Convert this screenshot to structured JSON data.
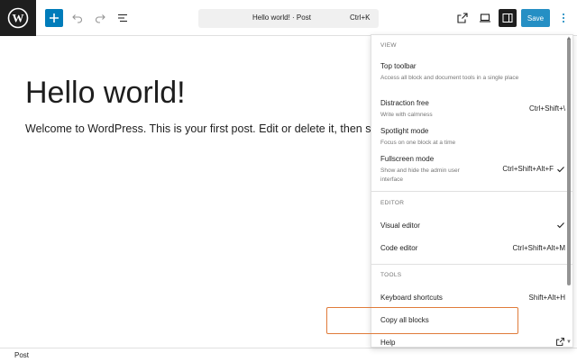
{
  "toolbar": {
    "logo_icon": "wordpress-icon",
    "add_icon": "plus-icon",
    "undo_icon": "undo-icon",
    "redo_icon": "redo-icon",
    "outline_icon": "list-view-icon",
    "document_title": "Hello world! · Post",
    "document_shortcut": "Ctrl+K",
    "view_icon": "external-link-icon",
    "preview_icon": "desktop-icon",
    "settings_icon": "sidebar-toggle-icon",
    "save_label": "Save",
    "options_icon": "more-vertical-icon"
  },
  "editor": {
    "title": "Hello world!",
    "body": "Welcome to WordPress. This is your first post. Edit or delete it, then start writing!"
  },
  "footer": {
    "label": "Post"
  },
  "menu": {
    "view": {
      "heading": "VIEW",
      "items": [
        {
          "label": "Top toolbar",
          "description": "Access all block and document tools in a single place",
          "shortcut": "",
          "checked": false
        },
        {
          "label": "Distraction free",
          "description": "Write with calmness",
          "shortcut": "Ctrl+Shift+\\",
          "checked": false
        },
        {
          "label": "Spotlight mode",
          "description": "Focus on one block at a time",
          "shortcut": "",
          "checked": false
        },
        {
          "label": "Fullscreen mode",
          "description": "Show and hide the admin user interface",
          "shortcut": "Ctrl+Shift+Alt+F",
          "checked": true
        }
      ]
    },
    "editor": {
      "heading": "EDITOR",
      "items": [
        {
          "label": "Visual editor",
          "shortcut": "",
          "checked": true
        },
        {
          "label": "Code editor",
          "shortcut": "Ctrl+Shift+Alt+M",
          "checked": false
        }
      ]
    },
    "tools": {
      "heading": "TOOLS",
      "items": [
        {
          "label": "Keyboard shortcuts",
          "shortcut": "Shift+Alt+H"
        },
        {
          "label": "Copy all blocks",
          "shortcut": ""
        },
        {
          "label": "Help",
          "shortcut": "",
          "icon": "external-link-icon"
        }
      ]
    }
  },
  "colors": {
    "accent": "#007cba",
    "dark": "#1e1e1e",
    "highlight": "#e07b3a"
  }
}
